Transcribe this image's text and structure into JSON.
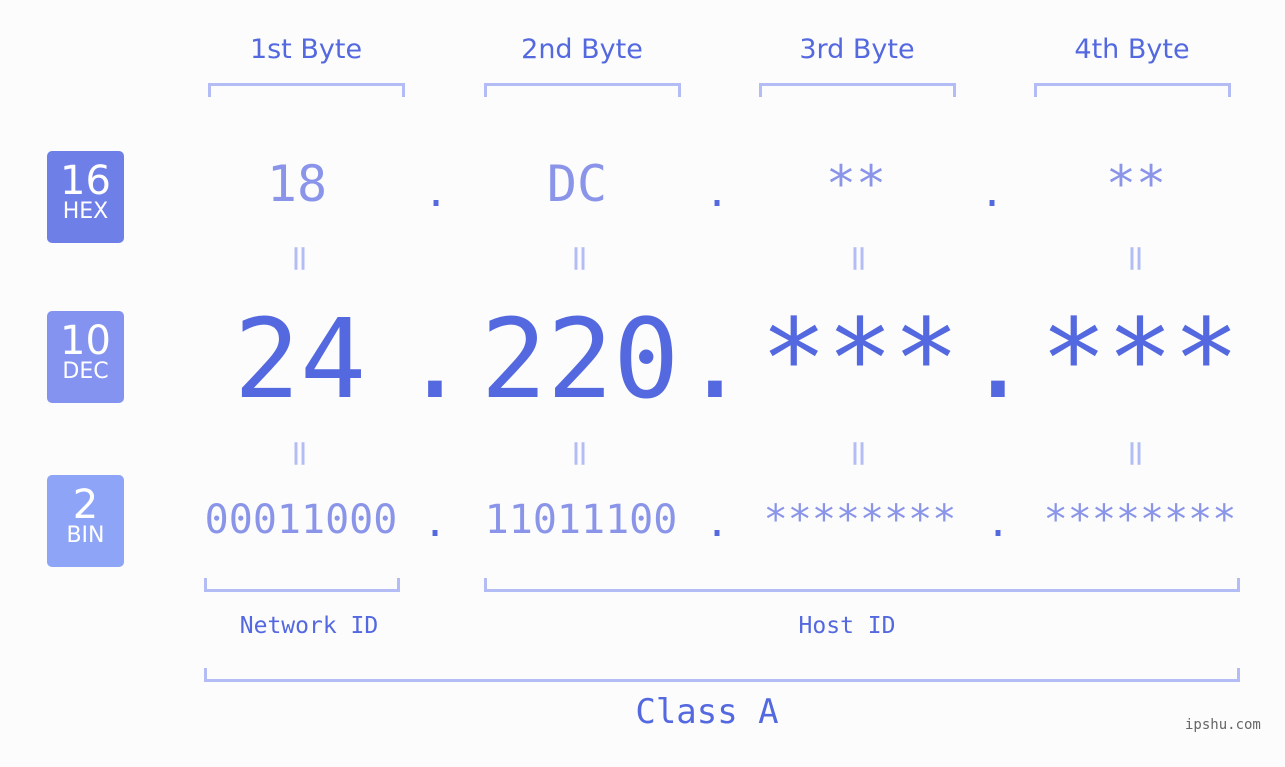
{
  "bytes": [
    {
      "label": "1st Byte",
      "hex": "18",
      "dec": "24",
      "bin": "00011000"
    },
    {
      "label": "2nd Byte",
      "hex": "DC",
      "dec": "220",
      "bin": "11011100"
    },
    {
      "label": "3rd Byte",
      "hex": "**",
      "dec": "***",
      "bin": "********"
    },
    {
      "label": "4th Byte",
      "hex": "**",
      "dec": "***",
      "bin": "********"
    }
  ],
  "badges": {
    "hex": {
      "num": "16",
      "label": "HEX",
      "color": "#6f7fe8"
    },
    "dec": {
      "num": "10",
      "label": "DEC",
      "color": "#8393ef"
    },
    "bin": {
      "num": "2",
      "label": "BIN",
      "color": "#8ea5f7"
    }
  },
  "separator": ".",
  "equals": "=",
  "network_id_label": "Network ID",
  "host_id_label": "Host ID",
  "class_label": "Class A",
  "watermark": "ipshu.com",
  "colors": {
    "accent": "#5468e0",
    "light": "#8a95ea",
    "bracket": "#b3bcf5"
  }
}
